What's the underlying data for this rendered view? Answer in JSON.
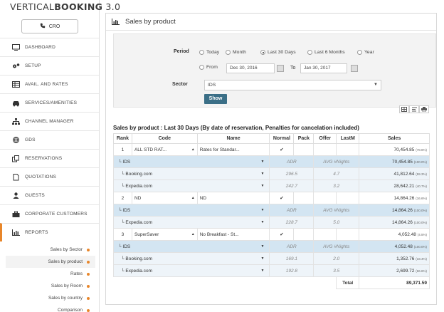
{
  "app": {
    "logo_light": "VERTICAL",
    "logo_bold": "BOOKING",
    "logo_version": " 3.0"
  },
  "cro_button": "CRO",
  "nav": [
    {
      "label": "DASHBOARD",
      "icon": "monitor-icon"
    },
    {
      "label": "SETUP",
      "icon": "gears-icon"
    },
    {
      "label": "AVAIL. AND RATES",
      "icon": "table-icon"
    },
    {
      "label": "SERVICES/AMENITIES",
      "icon": "car-icon"
    },
    {
      "label": "CHANNEL MANAGER",
      "icon": "sitemap-icon"
    },
    {
      "label": "GDS",
      "icon": "globe-icon"
    },
    {
      "label": "RESERVATIONS",
      "icon": "copy-icon"
    },
    {
      "label": "QUOTATIONS",
      "icon": "file-icon"
    },
    {
      "label": "GUESTS",
      "icon": "user-icon"
    },
    {
      "label": "CORPORATE CUSTOMERS",
      "icon": "briefcase-icon"
    },
    {
      "label": "REPORTS",
      "icon": "bar-chart-icon"
    }
  ],
  "reports_sub": [
    "Sales by Sector",
    "Sales by product",
    "Rates",
    "Sales by Room",
    "Sales by country",
    "Comparison"
  ],
  "panel_title": "Sales by product",
  "filters": {
    "period_label": "Period",
    "radios": [
      "Today",
      "Month",
      "Last 30 Days",
      "Last 6 Months",
      "Year"
    ],
    "from_label": "From",
    "from_value": "Dec 30, 2016",
    "to_label": "To",
    "to_value": "Jan 30, 2017",
    "sector_label": "Sector",
    "sector_value": "IDS",
    "show_button": "Show"
  },
  "report_title": "Sales by product : Last 30 Days (By date of reservation, Penalties for cancelation included)",
  "table": {
    "headers": [
      "Rank",
      "Code",
      "Name",
      "Normal",
      "Pack",
      "Offer",
      "LastM",
      "Sales"
    ],
    "rows": [
      {
        "type": "main",
        "rank": "1",
        "code": "ALL STD RAT...",
        "name": "Rates for Standar...",
        "normal": "✔",
        "sales": "70,454.85",
        "pct": "(78.6%)"
      },
      {
        "type": "sector",
        "label": "IDS",
        "adr": "ADR",
        "avg": "AVG #Nights",
        "sales": "70,454.85",
        "pct": "(100.0%)"
      },
      {
        "type": "channel",
        "label": "Booking.com",
        "adr": "296.5",
        "avg": "4.7",
        "sales": "41,812.64",
        "pct": "(59.3%)"
      },
      {
        "type": "channel",
        "label": "Expedia.com",
        "adr": "242.7",
        "avg": "3.2",
        "sales": "28,642.21",
        "pct": "(40.7%)"
      },
      {
        "type": "main",
        "rank": "2",
        "code": "ND",
        "name": "ND",
        "normal": "✔",
        "sales": "14,864.26",
        "pct": "(16.6%)"
      },
      {
        "type": "sector",
        "label": "IDS",
        "adr": "ADR",
        "avg": "AVG #Nights",
        "sales": "14,864.26",
        "pct": "(100.0%)"
      },
      {
        "type": "channel",
        "label": "Expedia.com",
        "adr": "228.7",
        "avg": "5.0",
        "sales": "14,864.26",
        "pct": "(100.0%)"
      },
      {
        "type": "main",
        "rank": "3",
        "code": "SuperSaver",
        "name": "No Breakfast - St...",
        "normal": "✔",
        "sales": "4,052.48",
        "pct": "(4.5%)"
      },
      {
        "type": "sector",
        "label": "IDS",
        "adr": "ADR",
        "avg": "AVG #Nights",
        "sales": "4,052.48",
        "pct": "(100.0%)"
      },
      {
        "type": "channel",
        "label": "Booking.com",
        "adr": "169.1",
        "avg": "2.0",
        "sales": "1,352.76",
        "pct": "(33.4%)"
      },
      {
        "type": "channel",
        "label": "Expedia.com",
        "adr": "192.8",
        "avg": "3.5",
        "sales": "2,699.72",
        "pct": "(66.6%)"
      }
    ],
    "total_label": "Total",
    "total_value": "89,371.59"
  }
}
